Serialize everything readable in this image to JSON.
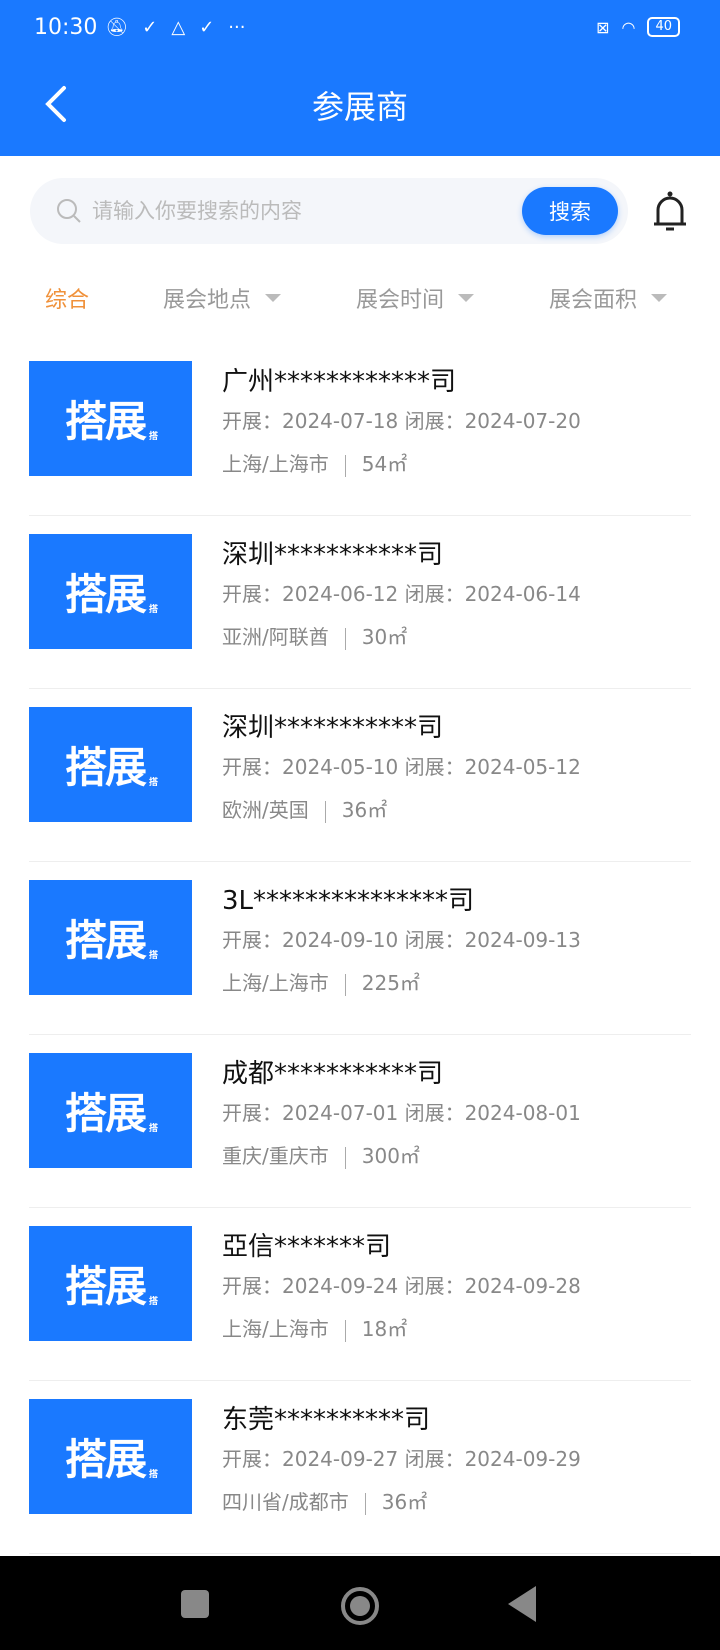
{
  "status": {
    "time": "10:30",
    "battery": "40"
  },
  "header": {
    "title": "参展商"
  },
  "search": {
    "placeholder": "请输入你要搜索的内容",
    "value": "",
    "button": "搜索"
  },
  "tabs": [
    {
      "label": "综合"
    },
    {
      "label": "展会地点"
    },
    {
      "label": "展会时间"
    },
    {
      "label": "展会面积"
    }
  ],
  "thumb_text": "搭展",
  "items": [
    {
      "name": "广州************司",
      "dates": "开展：2024-07-18  闭展：2024-07-20",
      "location": "上海/上海市",
      "area": "54㎡"
    },
    {
      "name": "深圳***********司",
      "dates": "开展：2024-06-12  闭展：2024-06-14",
      "location": "亚洲/阿联酋",
      "area": "30㎡"
    },
    {
      "name": "深圳***********司",
      "dates": "开展：2024-05-10  闭展：2024-05-12",
      "location": "欧洲/英国",
      "area": "36㎡"
    },
    {
      "name": "3L***************司",
      "dates": "开展：2024-09-10  闭展：2024-09-13",
      "location": "上海/上海市",
      "area": "225㎡"
    },
    {
      "name": "成都***********司",
      "dates": "开展：2024-07-01  闭展：2024-08-01",
      "location": "重庆/重庆市",
      "area": "300㎡"
    },
    {
      "name": "亞信*******司",
      "dates": "开展：2024-09-24  闭展：2024-09-28",
      "location": "上海/上海市",
      "area": "18㎡"
    },
    {
      "name": "东莞**********司",
      "dates": "开展：2024-09-27  闭展：2024-09-29",
      "location": "四川省/成都市",
      "area": "36㎡"
    }
  ],
  "colors": {
    "primary": "#1a79ff",
    "active_tab": "#f0913a"
  }
}
